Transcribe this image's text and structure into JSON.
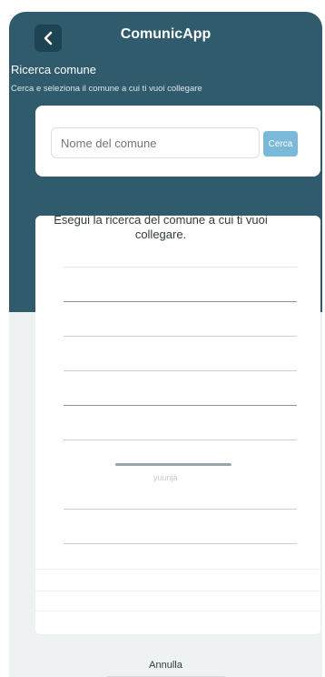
{
  "header": {
    "app_title": "ComunicApp",
    "back_icon": "chevron-left-icon"
  },
  "section": {
    "title": "Ricerca comune",
    "subtitle": "Cerca e seleziona il comune a cui ti vuoi collegare"
  },
  "search": {
    "placeholder": "Nome del comune",
    "button_label": "Cerca"
  },
  "sheet": {
    "message": "Esegui la ricerca del comune a cui ti vuoi collegare.",
    "ghost_text": "yuunja"
  },
  "footer": {
    "cancel_label": "Annulla"
  },
  "colors": {
    "header_background": "#2f5b6d",
    "search_button": "#7ab9d8",
    "back_button": "#1e4353"
  }
}
